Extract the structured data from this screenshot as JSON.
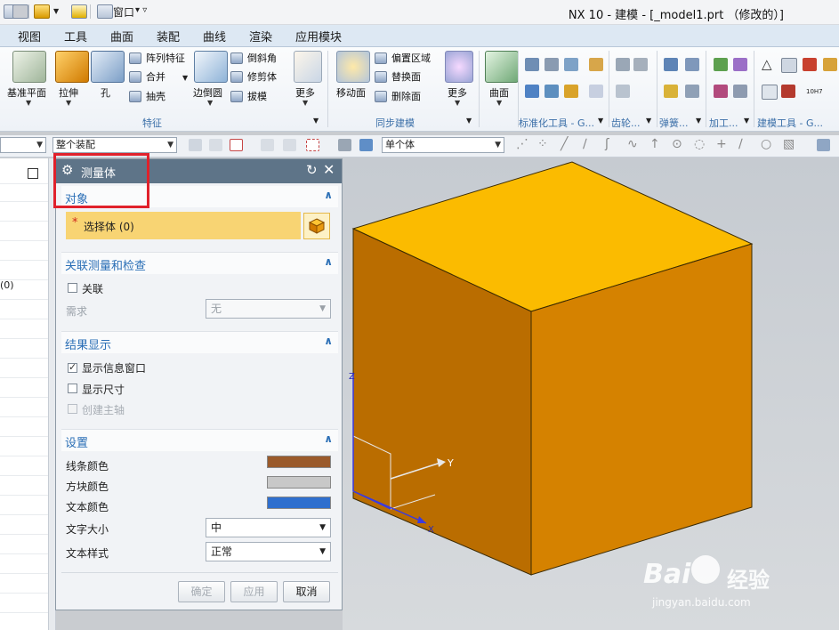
{
  "app": {
    "title": "NX 10 - 建模 - [_model1.prt （修改的）]",
    "window_menu": "窗口"
  },
  "menubar": [
    "视图",
    "工具",
    "曲面",
    "装配",
    "曲线",
    "渲染",
    "应用模块"
  ],
  "ribbon": {
    "big_buttons": [
      "基准平面",
      "拉伸",
      "孔",
      "边倒圆",
      "更多",
      "移动面",
      "更多",
      "曲面"
    ],
    "small_buttons": [
      "阵列特征",
      "合并",
      "抽壳",
      "倒斜角",
      "修剪体",
      "拔模",
      "偏置区域",
      "替换面",
      "删除面"
    ],
    "groups": [
      "特征",
      "同步建模",
      "标准化工具 - G...",
      "齿轮...",
      "弹簧...",
      "加工...",
      "建模工具 - G..."
    ],
    "tiny_labels": [
      "10H7"
    ]
  },
  "toolbar": {
    "combo_left": "",
    "assembly_filter": "整个装配",
    "select_filter": "单个体"
  },
  "navigator": {
    "partial_text": "(0)"
  },
  "dialog": {
    "title": "测量体",
    "sections": {
      "object": {
        "header": "对象",
        "required_marker": "*",
        "select_body": "选择体 (0)"
      },
      "associative": {
        "header": "关联测量和检查",
        "associative_label": "关联",
        "associative_checked": false,
        "requirement_label": "需求",
        "requirement_value": "无"
      },
      "results": {
        "header": "结果显示",
        "show_info_label": "显示信息窗口",
        "show_info_checked": true,
        "show_dims_label": "显示尺寸",
        "show_dims_checked": false,
        "create_owner_label": "创建主轴",
        "create_owner_checked": false
      },
      "settings": {
        "header": "设置",
        "line_color_label": "线条颜色",
        "line_color": "#9a5a2b",
        "block_color_label": "方块颜色",
        "block_color": "#c8c8c8",
        "text_color_label": "文本颜色",
        "text_color": "#2f6fce",
        "text_size_label": "文字大小",
        "text_size_value": "中",
        "text_style_label": "文本样式",
        "text_style_value": "正常"
      }
    },
    "buttons": {
      "ok": "确定",
      "apply": "应用",
      "cancel": "取消"
    }
  },
  "viewport": {
    "cube_top_color": "#fbbb00",
    "cube_left_color": "#ba6d00",
    "cube_right_color": "#d58200",
    "axis_labels": {
      "x": "X",
      "y": "Y",
      "z": "Z"
    }
  },
  "watermark": {
    "brand": "Bai",
    "brand_cn": "经验",
    "url": "jingyan.baidu.com"
  }
}
